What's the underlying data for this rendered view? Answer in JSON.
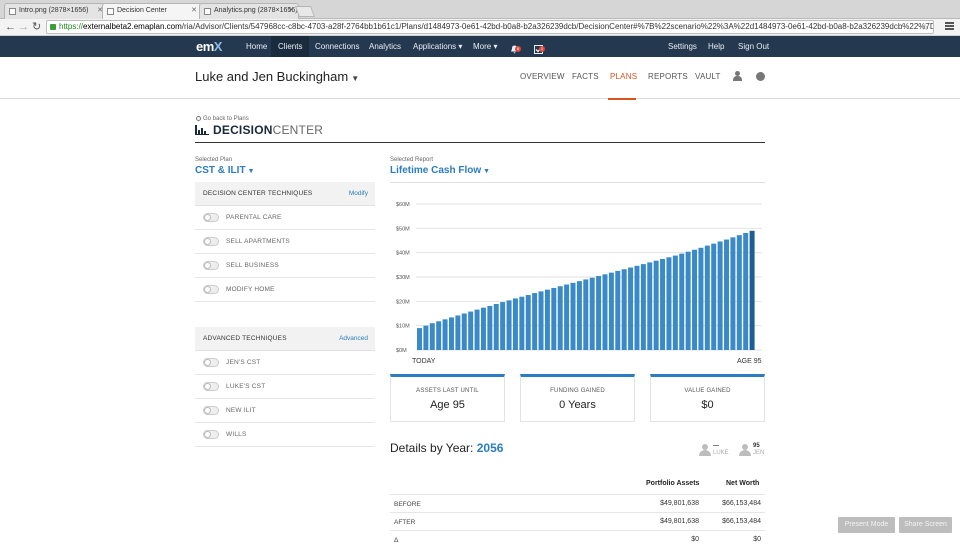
{
  "browser": {
    "tabs": [
      {
        "label": "Intro.png (2878×1656)",
        "active": false
      },
      {
        "label": "Decision Center",
        "active": true
      },
      {
        "label": "Analytics.png (2878×1656)",
        "active": false
      }
    ],
    "url_scheme": "https://",
    "url_host": "externalbeta2.emaplan.com",
    "url_path": "/ria/Advisor/Clients/547968cc-c8bc-4703-a28f-2764bb1b61c1/Plans/d1484973-0e61-42bd-b0a8-b2a326239dcb/DecisionCenter#%7B%22scenario%22%3A%22d1484973-0e61-42bd-b0a8-b2a326239dcb%22%7D"
  },
  "appnav": {
    "logo": "em",
    "logo_x": "X",
    "links": [
      "Home",
      "Clients",
      "Connections",
      "Analytics",
      "Applications ▾",
      "More ▾"
    ],
    "right_links": [
      "Settings",
      "Help",
      "Sign Out"
    ],
    "notif_count": "6",
    "task_count": "1"
  },
  "client": {
    "name": "Luke and Jen Buckingham",
    "tabs": [
      "OVERVIEW",
      "FACTS",
      "PLANS",
      "REPORTS",
      "VAULT"
    ],
    "active_tab": "PLANS"
  },
  "decision_center": {
    "go_back": "Go back to Plans",
    "title_bold": "DECISION",
    "title_light": "CENTER",
    "selected_plan_label": "Selected Plan",
    "selected_plan": "CST & ILIT",
    "selected_report_label": "Selected Report",
    "selected_report": "Lifetime Cash Flow"
  },
  "techniques": {
    "title": "DECISION CENTER TECHNIQUES",
    "action": "Modify",
    "items": [
      "PARENTAL CARE",
      "SELL APARTMENTS",
      "SELL BUSINESS",
      "MODIFY HOME"
    ]
  },
  "advanced": {
    "title": "ADVANCED TECHNIQUES",
    "action": "Advanced",
    "items": [
      "JEN'S CST",
      "LUKE'S CST",
      "NEW ILIT",
      "WILLS"
    ]
  },
  "chart_data": {
    "type": "bar",
    "ylim": [
      0,
      60
    ],
    "yunit": "M",
    "yticks": [
      "$0M",
      "$10M",
      "$20M",
      "$30M",
      "$40M",
      "$50M",
      "$60M"
    ],
    "x_start_label": "TODAY",
    "x_end_label": "AGE 95",
    "values": [
      9.0,
      10.0,
      11.0,
      11.8,
      12.6,
      13.4,
      14.2,
      15.0,
      15.8,
      16.6,
      17.4,
      18.1,
      18.9,
      19.7,
      20.4,
      21.2,
      21.9,
      22.6,
      23.4,
      24.1,
      24.8,
      25.5,
      26.2,
      26.9,
      27.6,
      28.3,
      29.0,
      29.7,
      30.4,
      31.1,
      31.8,
      32.5,
      33.2,
      33.9,
      34.6,
      35.3,
      36.0,
      36.7,
      37.4,
      38.1,
      38.8,
      39.6,
      40.4,
      41.2,
      42.0,
      42.9,
      43.7,
      44.6,
      45.4,
      46.3,
      47.2,
      48.1,
      49.0
    ],
    "highlight_index": 52,
    "bar_color": "#3a8ac8",
    "highlight_color": "#1d5e97"
  },
  "cards": [
    {
      "title": "ASSETS LAST UNTIL",
      "value": "Age 95"
    },
    {
      "title": "FUNDING GAINED",
      "value": "0 Years"
    },
    {
      "title": "VALUE GAINED",
      "value": "$0"
    }
  ],
  "details": {
    "title": "Details by Year:",
    "year": "2056",
    "luke_value": "—",
    "luke_label": "LUKE",
    "jen_value": "95",
    "jen_label": "JEN",
    "columns": [
      "Portfolio Assets",
      "Net Worth"
    ],
    "rows": [
      {
        "label": "BEFORE",
        "portfolio": "$49,801,638",
        "networth": "$66,153,484"
      },
      {
        "label": "AFTER",
        "portfolio": "$49,801,638",
        "networth": "$66,153,484"
      },
      {
        "label": "Δ",
        "portfolio": "$0",
        "networth": "$0"
      }
    ]
  },
  "footer_buttons": [
    "Present Mode",
    "Share Screen"
  ]
}
